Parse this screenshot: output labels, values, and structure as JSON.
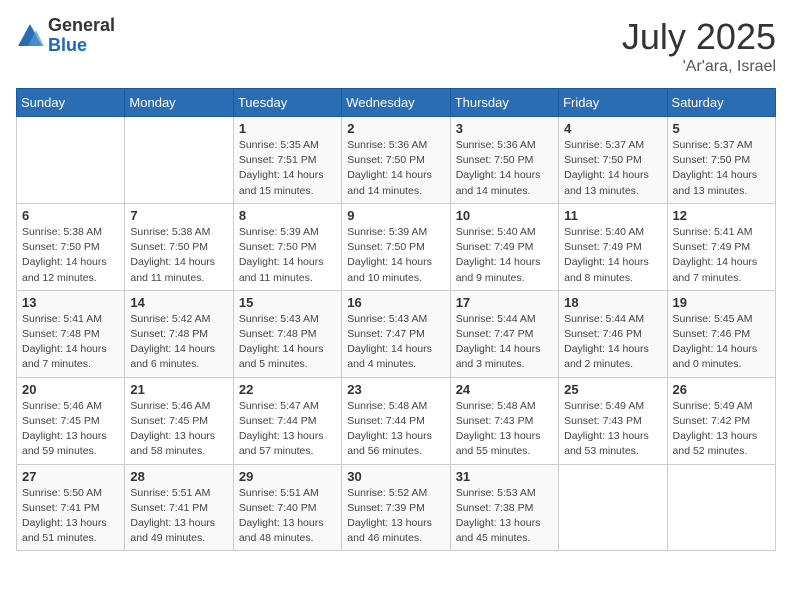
{
  "logo": {
    "general": "General",
    "blue": "Blue"
  },
  "header": {
    "month_year": "July 2025",
    "location": "'Ar'ara, Israel"
  },
  "days_of_week": [
    "Sunday",
    "Monday",
    "Tuesday",
    "Wednesday",
    "Thursday",
    "Friday",
    "Saturday"
  ],
  "weeks": [
    [
      {
        "day": "",
        "info": ""
      },
      {
        "day": "",
        "info": ""
      },
      {
        "day": "1",
        "info": "Sunrise: 5:35 AM\nSunset: 7:51 PM\nDaylight: 14 hours and 15 minutes."
      },
      {
        "day": "2",
        "info": "Sunrise: 5:36 AM\nSunset: 7:50 PM\nDaylight: 14 hours and 14 minutes."
      },
      {
        "day": "3",
        "info": "Sunrise: 5:36 AM\nSunset: 7:50 PM\nDaylight: 14 hours and 14 minutes."
      },
      {
        "day": "4",
        "info": "Sunrise: 5:37 AM\nSunset: 7:50 PM\nDaylight: 14 hours and 13 minutes."
      },
      {
        "day": "5",
        "info": "Sunrise: 5:37 AM\nSunset: 7:50 PM\nDaylight: 14 hours and 13 minutes."
      }
    ],
    [
      {
        "day": "6",
        "info": "Sunrise: 5:38 AM\nSunset: 7:50 PM\nDaylight: 14 hours and 12 minutes."
      },
      {
        "day": "7",
        "info": "Sunrise: 5:38 AM\nSunset: 7:50 PM\nDaylight: 14 hours and 11 minutes."
      },
      {
        "day": "8",
        "info": "Sunrise: 5:39 AM\nSunset: 7:50 PM\nDaylight: 14 hours and 11 minutes."
      },
      {
        "day": "9",
        "info": "Sunrise: 5:39 AM\nSunset: 7:50 PM\nDaylight: 14 hours and 10 minutes."
      },
      {
        "day": "10",
        "info": "Sunrise: 5:40 AM\nSunset: 7:49 PM\nDaylight: 14 hours and 9 minutes."
      },
      {
        "day": "11",
        "info": "Sunrise: 5:40 AM\nSunset: 7:49 PM\nDaylight: 14 hours and 8 minutes."
      },
      {
        "day": "12",
        "info": "Sunrise: 5:41 AM\nSunset: 7:49 PM\nDaylight: 14 hours and 7 minutes."
      }
    ],
    [
      {
        "day": "13",
        "info": "Sunrise: 5:41 AM\nSunset: 7:48 PM\nDaylight: 14 hours and 7 minutes."
      },
      {
        "day": "14",
        "info": "Sunrise: 5:42 AM\nSunset: 7:48 PM\nDaylight: 14 hours and 6 minutes."
      },
      {
        "day": "15",
        "info": "Sunrise: 5:43 AM\nSunset: 7:48 PM\nDaylight: 14 hours and 5 minutes."
      },
      {
        "day": "16",
        "info": "Sunrise: 5:43 AM\nSunset: 7:47 PM\nDaylight: 14 hours and 4 minutes."
      },
      {
        "day": "17",
        "info": "Sunrise: 5:44 AM\nSunset: 7:47 PM\nDaylight: 14 hours and 3 minutes."
      },
      {
        "day": "18",
        "info": "Sunrise: 5:44 AM\nSunset: 7:46 PM\nDaylight: 14 hours and 2 minutes."
      },
      {
        "day": "19",
        "info": "Sunrise: 5:45 AM\nSunset: 7:46 PM\nDaylight: 14 hours and 0 minutes."
      }
    ],
    [
      {
        "day": "20",
        "info": "Sunrise: 5:46 AM\nSunset: 7:45 PM\nDaylight: 13 hours and 59 minutes."
      },
      {
        "day": "21",
        "info": "Sunrise: 5:46 AM\nSunset: 7:45 PM\nDaylight: 13 hours and 58 minutes."
      },
      {
        "day": "22",
        "info": "Sunrise: 5:47 AM\nSunset: 7:44 PM\nDaylight: 13 hours and 57 minutes."
      },
      {
        "day": "23",
        "info": "Sunrise: 5:48 AM\nSunset: 7:44 PM\nDaylight: 13 hours and 56 minutes."
      },
      {
        "day": "24",
        "info": "Sunrise: 5:48 AM\nSunset: 7:43 PM\nDaylight: 13 hours and 55 minutes."
      },
      {
        "day": "25",
        "info": "Sunrise: 5:49 AM\nSunset: 7:43 PM\nDaylight: 13 hours and 53 minutes."
      },
      {
        "day": "26",
        "info": "Sunrise: 5:49 AM\nSunset: 7:42 PM\nDaylight: 13 hours and 52 minutes."
      }
    ],
    [
      {
        "day": "27",
        "info": "Sunrise: 5:50 AM\nSunset: 7:41 PM\nDaylight: 13 hours and 51 minutes."
      },
      {
        "day": "28",
        "info": "Sunrise: 5:51 AM\nSunset: 7:41 PM\nDaylight: 13 hours and 49 minutes."
      },
      {
        "day": "29",
        "info": "Sunrise: 5:51 AM\nSunset: 7:40 PM\nDaylight: 13 hours and 48 minutes."
      },
      {
        "day": "30",
        "info": "Sunrise: 5:52 AM\nSunset: 7:39 PM\nDaylight: 13 hours and 46 minutes."
      },
      {
        "day": "31",
        "info": "Sunrise: 5:53 AM\nSunset: 7:38 PM\nDaylight: 13 hours and 45 minutes."
      },
      {
        "day": "",
        "info": ""
      },
      {
        "day": "",
        "info": ""
      }
    ]
  ]
}
